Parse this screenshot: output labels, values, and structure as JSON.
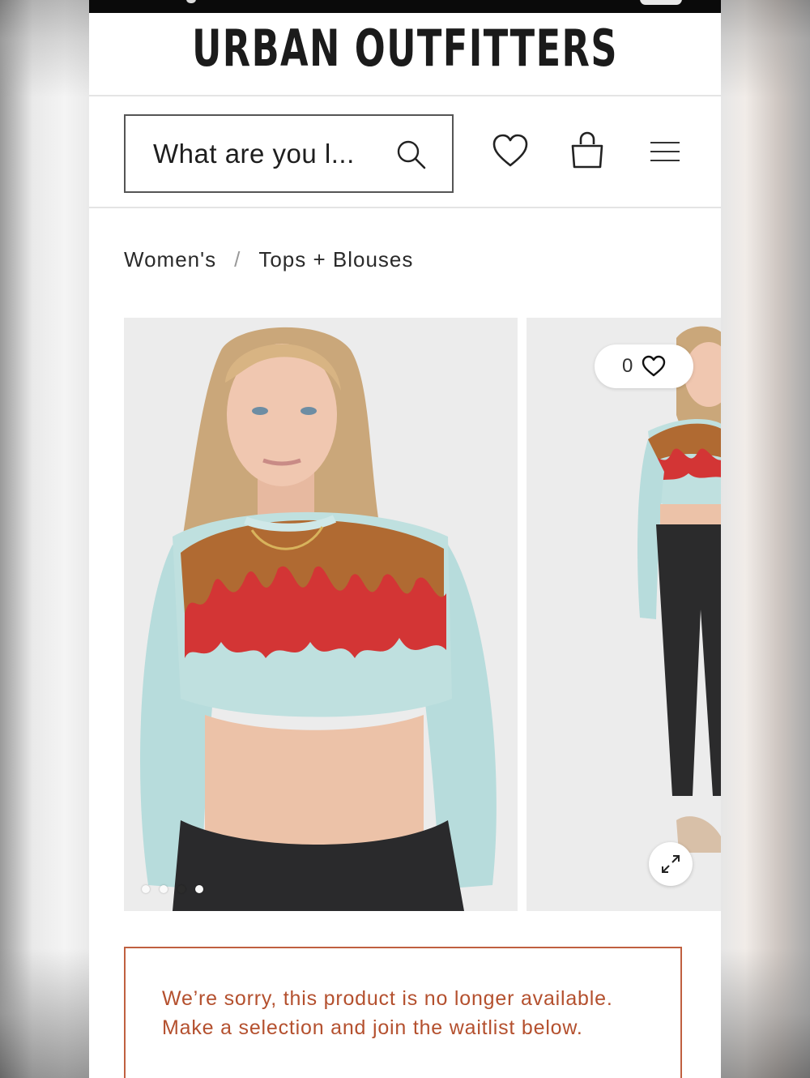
{
  "header": {
    "logo_text": "URBAN OUTFITTERS"
  },
  "search": {
    "placeholder": "What are you l..."
  },
  "header_icons": {
    "wishlist": "heart-icon",
    "cart": "shopping-bag-icon",
    "menu": "hamburger-menu-icon",
    "search": "search-icon"
  },
  "breadcrumb": {
    "items": [
      "Women's",
      "Tops + Blouses"
    ],
    "separator": "/"
  },
  "gallery": {
    "like_count": "0",
    "dots_total": 4,
    "dots_active_index": 2,
    "expand_icon": "expand-icon"
  },
  "notice": {
    "line1": "We’re sorry, this product is no longer available.",
    "line2": "Make a selection and join the waitlist below.",
    "color": "#b4502e"
  }
}
